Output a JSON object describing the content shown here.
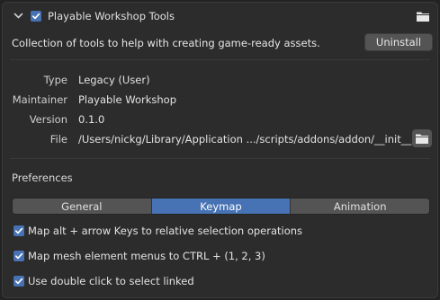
{
  "header": {
    "title": "Playable Workshop Tools",
    "enabled": true,
    "expanded": true
  },
  "description": "Collection of tools to help with creating game-ready assets.",
  "uninstall_label": "Uninstall",
  "info": {
    "type_label": "Type",
    "type_value": "Legacy (User)",
    "maintainer_label": "Maintainer",
    "maintainer_value": "Playable Workshop",
    "version_label": "Version",
    "version_value": "0.1.0",
    "file_label": "File",
    "file_value": "/Users/nickg/Library/Application .../scripts/addons/addon/__init__.py"
  },
  "preferences": {
    "title": "Preferences",
    "tabs": [
      {
        "label": "General",
        "active": false
      },
      {
        "label": "Keymap",
        "active": true
      },
      {
        "label": "Animation",
        "active": false
      }
    ],
    "options": [
      {
        "label": "Map alt + arrow Keys to relative selection operations",
        "checked": true
      },
      {
        "label": "Map mesh element menus to CTRL + (1, 2, 3)",
        "checked": true
      },
      {
        "label": "Use double click to select linked",
        "checked": true
      }
    ]
  },
  "colors": {
    "accent": "#4772b3",
    "panel": "#2c2c2c",
    "button": "#545454"
  },
  "icons": [
    "chevron-down-icon",
    "checkbox-icon",
    "folder-icon"
  ]
}
